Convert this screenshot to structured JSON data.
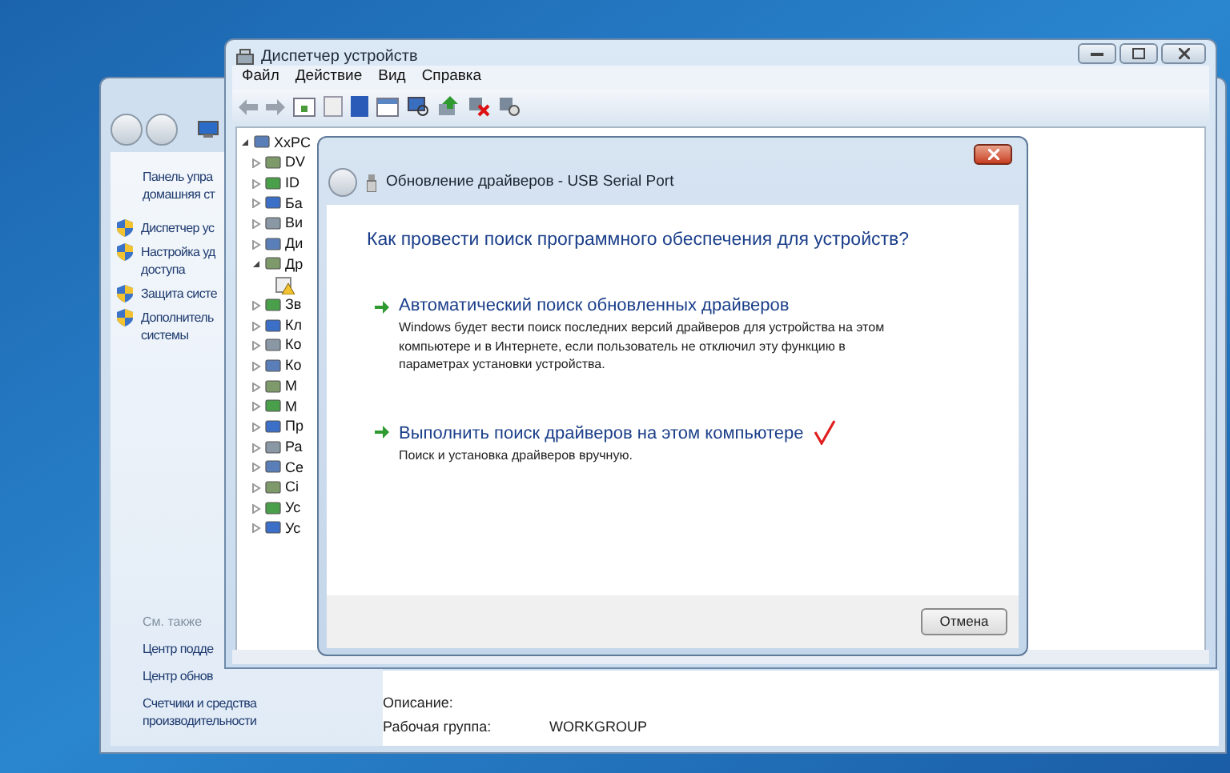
{
  "control_panel": {
    "home_link": [
      "Панель упра",
      "домашняя ст"
    ],
    "nav_links": [
      {
        "lines": [
          "Диспетчер ус"
        ]
      },
      {
        "lines": [
          "Настройка уд",
          "доступа"
        ]
      },
      {
        "lines": [
          "Защита систе"
        ]
      },
      {
        "lines": [
          "Дополнитель",
          "системы"
        ]
      }
    ],
    "see_also": "См. также",
    "see_also_links": [
      {
        "lines": [
          "Центр подде"
        ]
      },
      {
        "lines": [
          "Центр обнов"
        ]
      },
      {
        "lines": [
          "Счетчики и средства",
          "производительности"
        ]
      }
    ],
    "details": [
      {
        "label": "Описание:"
      },
      {
        "label": "Рабочая группа:",
        "value": "WORKGROUP"
      }
    ]
  },
  "device_manager": {
    "title": "Диспетчер устройств",
    "menu": [
      "Файл",
      "Действие",
      "Вид",
      "Справка"
    ],
    "tree": {
      "label": "XxPC",
      "expanded": true,
      "children": [
        {
          "label": "DV",
          "expanded": false
        },
        {
          "label": "ID",
          "expanded": false
        },
        {
          "label": "Ба",
          "expanded": false
        },
        {
          "label": "Ви",
          "expanded": false
        },
        {
          "label": "Ди",
          "expanded": false
        },
        {
          "label": "Др",
          "expanded": true,
          "children": [
            {
              "warning": true
            }
          ]
        },
        {
          "label": "Зв",
          "expanded": false
        },
        {
          "label": "Кл",
          "expanded": false
        },
        {
          "label": "Ко",
          "expanded": false
        },
        {
          "label": "Ко",
          "expanded": false
        },
        {
          "label": "М",
          "expanded": false
        },
        {
          "label": "М",
          "expanded": false
        },
        {
          "label": "Пр",
          "expanded": false
        },
        {
          "label": "Ра",
          "expanded": false
        },
        {
          "label": "Се",
          "expanded": false
        },
        {
          "label": "Сі",
          "expanded": false
        },
        {
          "label": "Ус",
          "expanded": false
        },
        {
          "label": "Ус",
          "expanded": false
        }
      ]
    }
  },
  "dialog": {
    "title": "Обновление драйверов - USB Serial Port",
    "heading": "Как провести поиск программного обеспечения для устройств?",
    "options": [
      {
        "title": "Автоматический поиск обновленных драйверов",
        "description": "Windows будет вести поиск последних версий драйверов для устройства на этом компьютере и в Интернете, если пользователь не отключил эту функцию в параметрах установки устройства.",
        "marked": false
      },
      {
        "title": "Выполнить поиск драйверов на этом компьютере",
        "description": "Поиск и установка драйверов вручную.",
        "marked": true
      }
    ],
    "cancel_button": "Отмена"
  }
}
